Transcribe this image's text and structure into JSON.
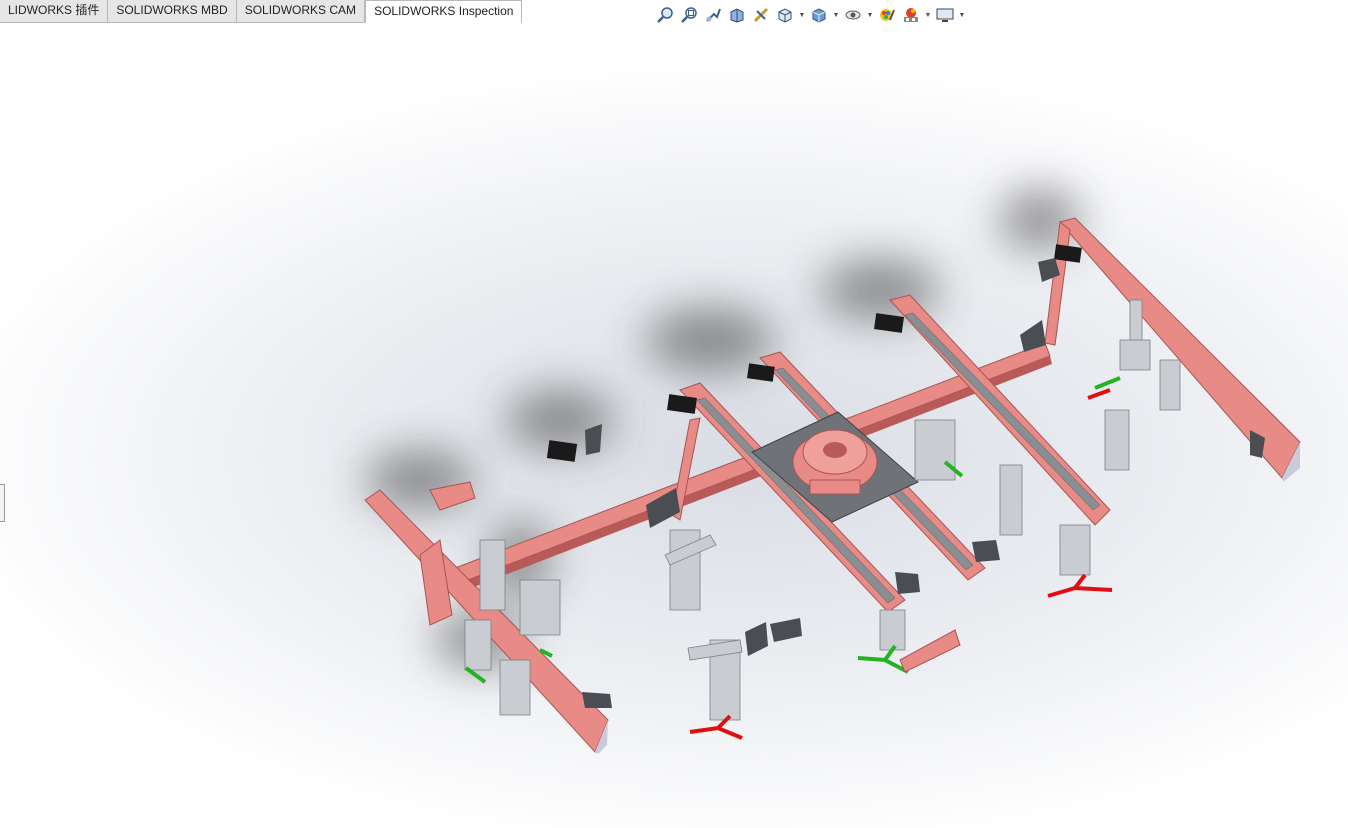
{
  "command_manager": {
    "tabs": [
      {
        "label": "LIDWORKS 插件",
        "active": false
      },
      {
        "label": "SOLIDWORKS MBD",
        "active": false
      },
      {
        "label": "SOLIDWORKS CAM",
        "active": false
      },
      {
        "label": "SOLIDWORKS Inspection",
        "active": true
      }
    ]
  },
  "heads_up_toolbar": {
    "icons": [
      "zoom-to-fit-icon",
      "zoom-to-area-icon",
      "previous-view-icon",
      "section-view-icon",
      "dynamic-annotation-views-icon",
      "view-orientation-icon",
      "display-style-icon",
      "hide-show-items-icon",
      "edit-appearance-icon",
      "apply-scene-icon",
      "view-settings-icon"
    ]
  },
  "model": {
    "frame_color": "#e88a86",
    "frame_shade_color": "#b85b58",
    "steel_color": "#8a8d92",
    "clamp_color": "#c9ccd0",
    "plate_color": "#6f7277",
    "handle_red": "#e01010",
    "handle_green": "#22b422"
  }
}
